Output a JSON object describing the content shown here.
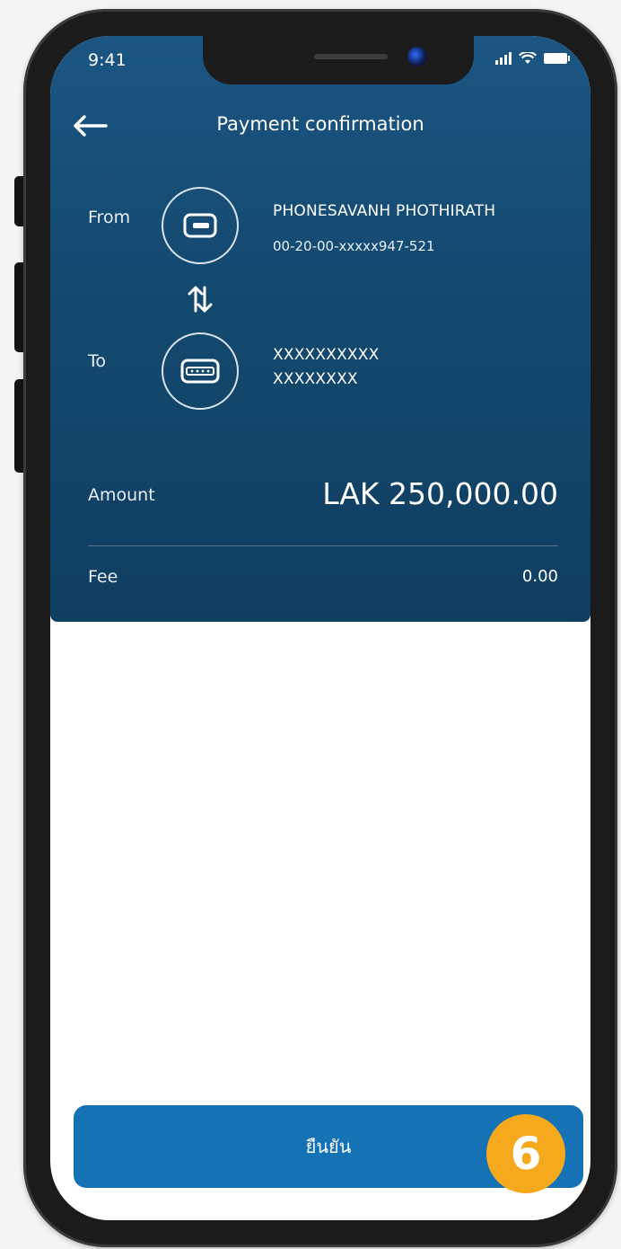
{
  "status_bar": {
    "time": "9:41"
  },
  "header": {
    "title": "Payment confirmation"
  },
  "from": {
    "label": "From",
    "name": "PHONESAVANH PHOTHIRATH",
    "account": "00-20-00-xxxxx947-521"
  },
  "to": {
    "label": "To",
    "name": "XXXXXXXXXX",
    "account": "XXXXXXXX"
  },
  "amount": {
    "label": "Amount",
    "value": "LAK 250,000.00"
  },
  "fee": {
    "label": "Fee",
    "value": "0.00"
  },
  "confirm_button": {
    "label": "ยืนยัน"
  },
  "step_badge": {
    "number": "6"
  },
  "colors": {
    "header_bg": "#14496f",
    "button_bg": "#1572b5",
    "badge_bg": "#f6a91d"
  },
  "icons": [
    "back-arrow-icon",
    "wallet-card-icon",
    "swap-arrows-icon",
    "pin-card-icon",
    "signal-icon",
    "wifi-icon",
    "battery-icon"
  ]
}
